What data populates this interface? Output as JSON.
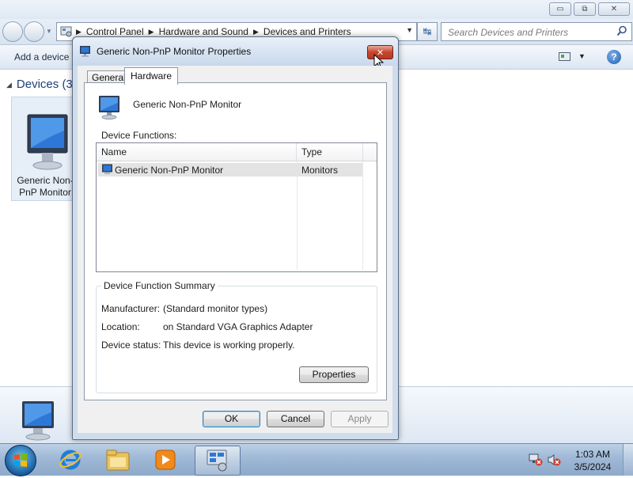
{
  "explorer": {
    "breadcrumbs": [
      "Control Panel",
      "Hardware and Sound",
      "Devices and Printers"
    ],
    "search_placeholder": "Search Devices and Printers",
    "command_bar": {
      "add_device": "Add a device"
    },
    "group_header": "Devices (3)",
    "device_tile_label": "Generic Non-PnP Monitor",
    "window_buttons": {
      "minimize": "▭",
      "maximize": "⧉",
      "close": "✕"
    }
  },
  "dialog": {
    "title": "Generic Non-PnP Monitor Properties",
    "close_label": "✕",
    "tabs": [
      {
        "label": "General",
        "selected": false
      },
      {
        "label": "Hardware",
        "selected": true
      }
    ],
    "device_name": "Generic Non-PnP Monitor",
    "device_functions_label": "Device Functions:",
    "columns": [
      "Name",
      "Type"
    ],
    "rows": [
      {
        "name": "Generic Non-PnP Monitor",
        "type": "Monitors",
        "selected": true
      }
    ],
    "summary": {
      "legend": "Device Function Summary",
      "manufacturer_label": "Manufacturer:",
      "manufacturer_value": "(Standard monitor types)",
      "location_label": "Location:",
      "location_value": "on Standard VGA Graphics Adapter",
      "status_label": "Device status:",
      "status_value": "This device is working properly."
    },
    "buttons": {
      "properties": "Properties",
      "ok": "OK",
      "cancel": "Cancel",
      "apply": "Apply"
    }
  },
  "taskbar": {
    "time": "1:03 AM",
    "date": "3/5/2024",
    "pinned": [
      "internet-explorer-icon",
      "windows-explorer-icon",
      "media-player-icon",
      "devices-and-printers-icon"
    ]
  },
  "colors": {
    "accent": "#3c7fb1",
    "close_red": "#c8442c",
    "selection": "#e3e3e3"
  }
}
